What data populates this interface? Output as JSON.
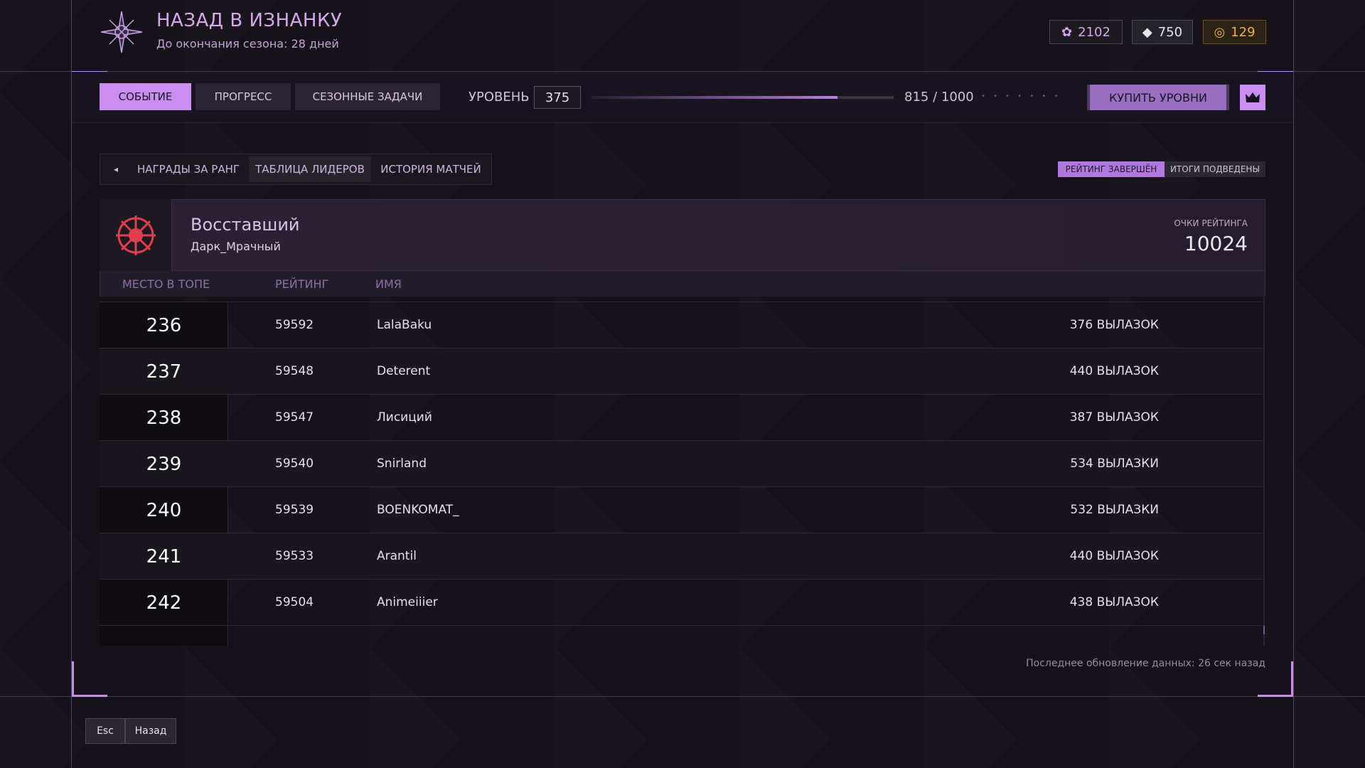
{
  "header": {
    "title": "НАЗАД В ИЗНАНКУ",
    "subtitle": "До окончания сезона: 28 дней",
    "currencies": [
      {
        "icon": "flower-icon",
        "value": "2102",
        "color": "#d6a6ee"
      },
      {
        "icon": "shard-icon",
        "value": "750",
        "color": "#e8e6ea"
      },
      {
        "icon": "coin-icon",
        "value": "129",
        "color": "#efb240"
      }
    ]
  },
  "tabs": [
    "СОБЫТИЕ",
    "ПРОГРЕСС",
    "СЕЗОННЫЕ ЗАДАЧИ"
  ],
  "level": {
    "label": "УРОВЕНЬ",
    "value": "375",
    "progress_text": "815 / 1000",
    "progress_fraction": 0.815,
    "dots": "• • • • • • •"
  },
  "buy_levels_label": "КУПИТЬ УРОВНИ",
  "subtabs": {
    "back_arrow": "◂",
    "items": [
      "НАГРАДЫ ЗА РАНГ",
      "ТАБЛИЦА ЛИДЕРОВ",
      "ИСТОРИЯ МАТЧЕЙ"
    ],
    "active": "ТАБЛИЦА ЛИДЕРОВ"
  },
  "badges": {
    "rating_done": "РЕЙТИНГ ЗАВЕРШЁН",
    "results": "ИТОГИ ПОДВЕДЕНЫ"
  },
  "player": {
    "title": "Восставший",
    "name": "Дарк_Мрачный",
    "points_label": "ОЧКИ РЕЙТИНГА",
    "points": "10024"
  },
  "table": {
    "columns": [
      "МЕСТО В ТОПЕ",
      "РЕЙТИНГ",
      "ИМЯ"
    ],
    "rows": [
      {
        "rank": "236",
        "rating": "59592",
        "name": "LalaBaku",
        "sorties": "376 ВЫЛАЗОК"
      },
      {
        "rank": "237",
        "rating": "59548",
        "name": "Deterent",
        "sorties": "440 ВЫЛАЗОК"
      },
      {
        "rank": "238",
        "rating": "59547",
        "name": "Лисиций",
        "sorties": "387 ВЫЛАЗОК"
      },
      {
        "rank": "239",
        "rating": "59540",
        "name": "Snirland",
        "sorties": "534 ВЫЛАЗКИ"
      },
      {
        "rank": "240",
        "rating": "59539",
        "name": "BOENKOMAT_",
        "sorties": "532 ВЫЛАЗКИ"
      },
      {
        "rank": "241",
        "rating": "59533",
        "name": "Arantil",
        "sorties": "440 ВЫЛАЗОК"
      },
      {
        "rank": "242",
        "rating": "59504",
        "name": "Animeiiier",
        "sorties": "438 ВЫЛАЗОК"
      }
    ]
  },
  "update_note": "Последнее обновление данных: 26 сек назад",
  "footer": {
    "esc": "Esc",
    "back": "Назад"
  }
}
